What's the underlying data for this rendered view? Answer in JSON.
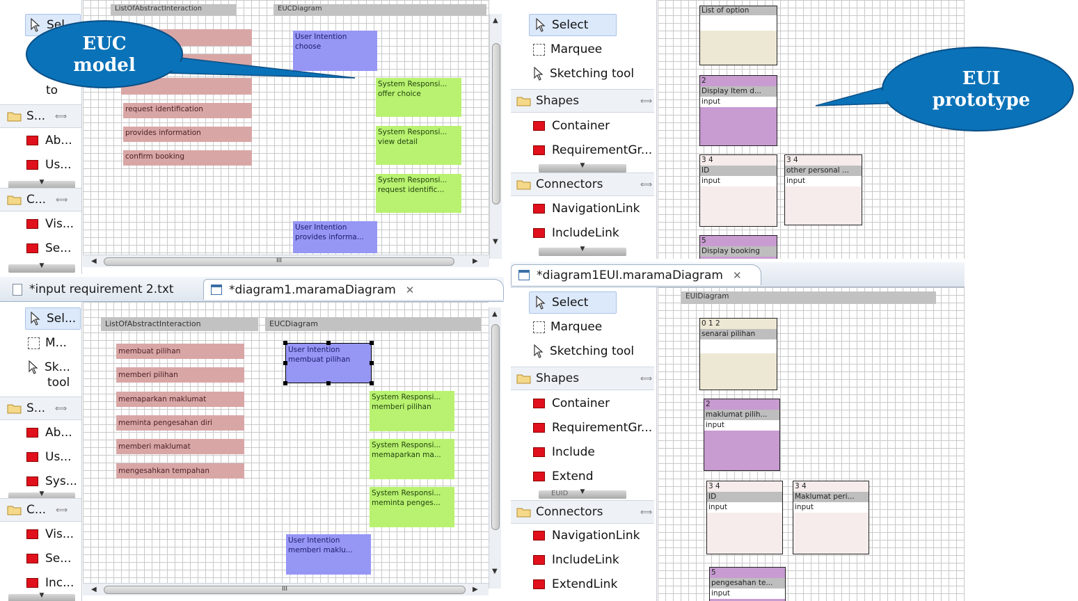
{
  "top_left": {
    "palette": {
      "select_label": "Sel...",
      "marquee_label": "",
      "sketch_label": "to",
      "shapes_drawer": "S...",
      "items": [
        "Ab...",
        "Us..."
      ],
      "connectors_drawer": "C...",
      "conn_items": [
        "Vis...",
        "Se..."
      ]
    },
    "headers": {
      "left": "ListOfAbstractInteraction",
      "right": "EUCDiagram"
    },
    "abstract_items": [
      "request identification",
      "provides information",
      "confirm booking"
    ],
    "blue_boxes": [
      {
        "line1": "User Intention",
        "line2": "choose"
      },
      {
        "line1": "User Intention",
        "line2": "provides informa..."
      }
    ],
    "green_boxes": [
      {
        "line1": "System Responsi...",
        "line2": "offer choice"
      },
      {
        "line1": "System Responsi...",
        "line2": "view detail"
      },
      {
        "line1": "System Responsi...",
        "line2": "request identific..."
      }
    ]
  },
  "top_right": {
    "palette": {
      "select_label": "Select",
      "marquee_label": "Marquee",
      "sketch_label": "Sketching tool",
      "shapes_drawer": "Shapes",
      "items": [
        "Container",
        "RequirementGr..."
      ],
      "connectors_drawer": "Connectors",
      "conn_items": [
        "NavigationLink",
        "IncludeLink"
      ]
    },
    "eui": {
      "list_label": "List of option",
      "display_num": "2",
      "display_label": "Display Item d...",
      "display_input": "input",
      "id_num": "3 4",
      "id_label": "ID",
      "id_input": "input",
      "other_num": "3 4",
      "other_label": "other personal ...",
      "other_input": "input",
      "bottom_num": "5",
      "bottom_label": "Display booking"
    }
  },
  "bottom_left": {
    "tabs": {
      "tab1": "*input requirement 2.txt",
      "tab2": "*diagram1.maramaDiagram"
    },
    "palette": {
      "select_label": "Sel...",
      "marquee_label": "M...",
      "sketch_label": "Sk...",
      "sketch_label2": "tool",
      "shapes_drawer": "S...",
      "items": [
        "Ab...",
        "Us...",
        "Sys..."
      ],
      "connectors_drawer": "C...",
      "conn_items": [
        "Vis...",
        "Se...",
        "Inc..."
      ]
    },
    "headers": {
      "left": "ListOfAbstractInteraction",
      "right": "EUCDiagram"
    },
    "abstract_items": [
      "membuat pilihan",
      "memberi pilihan",
      "memaparkan maklumat",
      "meminta pengesahan diri",
      "memberi maklumat",
      "mengesahkan tempahan"
    ],
    "blue_boxes": [
      {
        "line1": "User Intention",
        "line2": "membuat pilihan"
      },
      {
        "line1": "User Intention",
        "line2": "memberi maklu..."
      }
    ],
    "green_boxes": [
      {
        "line1": "System Responsi...",
        "line2": "memberi pilihan"
      },
      {
        "line1": "System Responsi...",
        "line2": "memaparkan ma..."
      },
      {
        "line1": "System Responsi...",
        "line2": "meminta penges..."
      }
    ],
    "hscroll_marker": "III"
  },
  "bottom_right": {
    "tab": "*diagram1EUI.maramaDiagram",
    "palette": {
      "select_label": "Select",
      "marquee_label": "Marquee",
      "sketch_label": "Sketching tool",
      "shapes_drawer": "Shapes",
      "items": [
        "Container",
        "RequirementGr...",
        "Include",
        "Extend"
      ],
      "hidden_item": "EUID",
      "connectors_drawer": "Connectors",
      "conn_items": [
        "NavigationLink",
        "IncludeLink",
        "ExtendLink"
      ]
    },
    "eui": {
      "header": "EUIDiagram",
      "list_num": "0 1 2",
      "list_label": "senarai pilihan",
      "m_num": "2",
      "m_label": "maklumat pilih...",
      "m_input": "input",
      "id_num": "3 4",
      "id_label": "ID",
      "id_input": "input",
      "mp_num": "3 4",
      "mp_label": "Maklumat peri...",
      "mp_input": "input",
      "p_num": "5",
      "p_label": "pengesahan te...",
      "p_input": "input"
    }
  },
  "callouts": {
    "euc_line1": "EUC",
    "euc_line2": "model",
    "eui_line1": "EUI",
    "eui_line2": "prototype"
  },
  "colors": {
    "callout_fill": "#0a72b8",
    "pink": "#d9a6a6",
    "blue": "#9696f5",
    "green": "#b8f270",
    "purple": "#c89bd1"
  }
}
